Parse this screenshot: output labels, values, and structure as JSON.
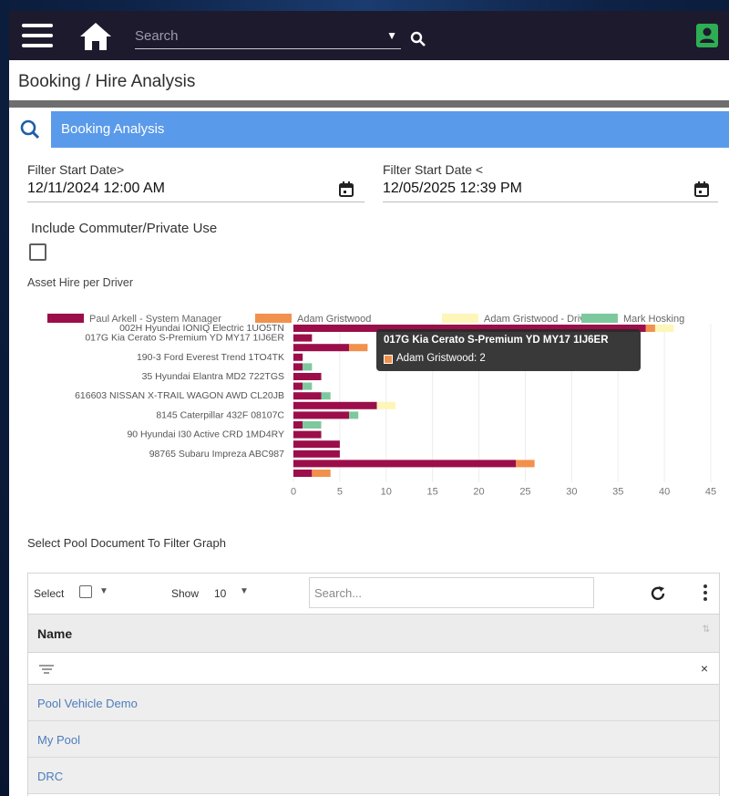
{
  "header": {
    "search_placeholder": "Search",
    "page_title": "Booking / Hire Analysis",
    "panel_title": "Booking Analysis"
  },
  "filters": {
    "start_gt_label": "Filter Start Date>",
    "start_gt_value": "12/11/2024 12:00 AM",
    "start_lt_label": "Filter Start Date <",
    "start_lt_value": "12/05/2025 12:39 PM",
    "commuter_label": "Include Commuter/Private Use",
    "commuter_checked": false
  },
  "chart_data": {
    "type": "bar",
    "orientation": "horizontal",
    "stacked": true,
    "title": "Asset Hire per Driver",
    "legend_position": "top",
    "categories": [
      "002H Hyundai IONIQ Electric 1UO5TN",
      "017G Kia Cerato S-Premium YD MY17 1IJ6ER",
      "",
      "190-3 Ford Everest Trend 1TO4TK",
      "",
      "35 Hyundai Elantra MD2 722TGS",
      "",
      "616603 NISSAN X-TRAIL WAGON AWD CL20JB",
      "",
      "8145 Caterpillar 432F 08107C",
      "",
      "90 Hyundai I30 Active CRD 1MD4RY",
      "",
      "98765 Subaru Impreza ABC987",
      ""
    ],
    "series": [
      {
        "name": "Paul Arkell - System Manager",
        "color": "#9b0e4a",
        "values": [
          38,
          2,
          6,
          1,
          1,
          3,
          1,
          3,
          9,
          6,
          1,
          3,
          5,
          5,
          24,
          2
        ]
      },
      {
        "name": "Adam Gristwood",
        "color": "#f2914d",
        "values": [
          1,
          0,
          2,
          0,
          0,
          0,
          0,
          0,
          0,
          0,
          0,
          0,
          0,
          0,
          2,
          2
        ]
      },
      {
        "name": "Adam Gristwood - Driver",
        "color": "#fdf6b8",
        "values": [
          2,
          0,
          0,
          0,
          0,
          0,
          0,
          0,
          2,
          0,
          0,
          0,
          0,
          0,
          0,
          0
        ]
      },
      {
        "name": "Mark Hosking",
        "color": "#7dc99d",
        "values": [
          0,
          0,
          0,
          0,
          1,
          0,
          1,
          1,
          0,
          1,
          2,
          0,
          0,
          0,
          0,
          0
        ]
      }
    ],
    "x_ticks": [
      "0",
      "5",
      "10",
      "15",
      "20",
      "25",
      "30",
      "35",
      "40",
      "45"
    ],
    "xlim": [
      0,
      45
    ],
    "grid": true,
    "tooltip": {
      "title": "017G Kia Cerato S-Premium YD MY17 1IJ6ER",
      "line": "Adam Gristwood: 2"
    }
  },
  "pool": {
    "label": "Select Pool Document To Filter Graph",
    "select_label": "Select",
    "show_label": "Show",
    "show_value": "10",
    "search_placeholder": "Search...",
    "name_header": "Name",
    "clear_glyph": "×",
    "rows": [
      "Pool Vehicle Demo",
      "My Pool",
      "DRC"
    ]
  }
}
